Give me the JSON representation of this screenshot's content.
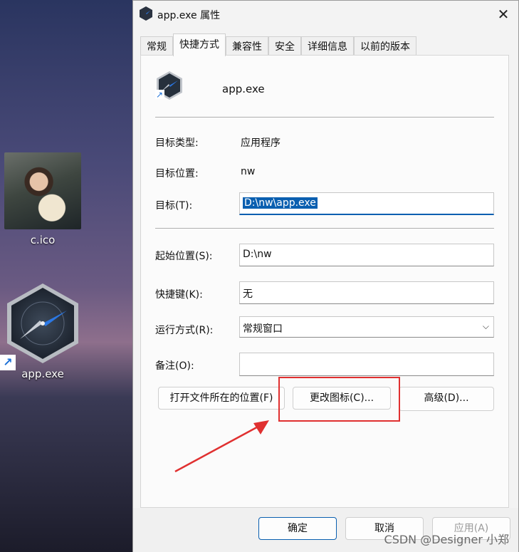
{
  "desktop": {
    "icons": [
      {
        "label": "c.ico"
      },
      {
        "label": "app.exe"
      }
    ]
  },
  "window": {
    "title": "app.exe 属性",
    "close_glyph": "✕"
  },
  "tabs": [
    {
      "label": "常规"
    },
    {
      "label": "快捷方式"
    },
    {
      "label": "兼容性"
    },
    {
      "label": "安全"
    },
    {
      "label": "详细信息"
    },
    {
      "label": "以前的版本"
    }
  ],
  "shortcut": {
    "app_name": "app.exe",
    "target_type_label": "目标类型:",
    "target_type_value": "应用程序",
    "target_location_label": "目标位置:",
    "target_location_value": "nw",
    "target_label": "目标(T):",
    "target_value": "D:\\nw\\app.exe",
    "start_in_label": "起始位置(S):",
    "start_in_value": "D:\\nw",
    "hotkey_label": "快捷键(K):",
    "hotkey_value": "无",
    "run_label": "运行方式(R):",
    "run_value": "常规窗口",
    "comment_label": "备注(O):",
    "comment_value": "",
    "open_location_button": "打开文件所在的位置(F)",
    "change_icon_button": "更改图标(C)...",
    "advanced_button": "高级(D)..."
  },
  "footer": {
    "ok": "确定",
    "cancel": "取消",
    "apply": "应用(A)"
  },
  "watermark": "CSDN @Designer 小郑",
  "colors": {
    "accent": "#0a5fb0",
    "annotation": "#e03030"
  }
}
